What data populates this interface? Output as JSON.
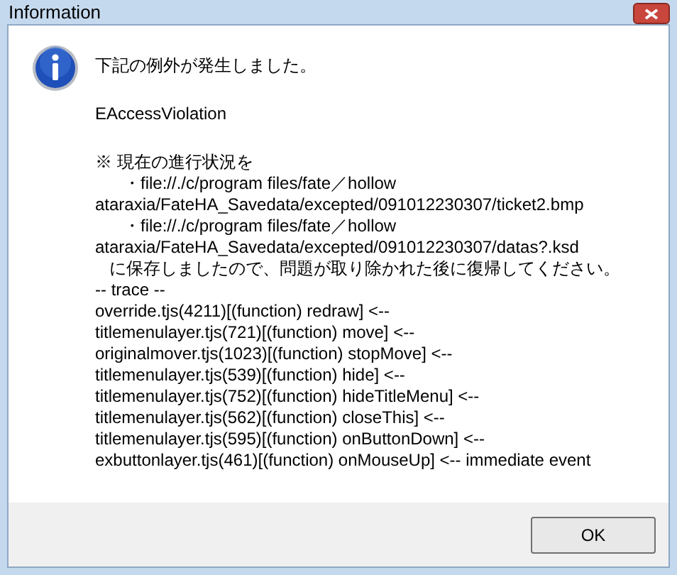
{
  "window": {
    "title": "Information"
  },
  "paragraphs": [
    [
      {
        "kind": "plain",
        "text": "下記の例外が発生しました。"
      }
    ],
    [
      {
        "kind": "plain",
        "text": "EAccessViolation"
      }
    ],
    [
      {
        "kind": "plain",
        "text": "※ 現在の進行状況を"
      },
      {
        "kind": "bullet",
        "text": "・file://./c/program files/fate／hollow"
      },
      {
        "kind": "plain",
        "text": "ataraxia/FateHA_Savedata/excepted/091012230307/ticket2.bmp"
      },
      {
        "kind": "bullet",
        "text": "・file://./c/program files/fate／hollow"
      },
      {
        "kind": "plain",
        "text": "ataraxia/FateHA_Savedata/excepted/091012230307/datas?.ksd"
      },
      {
        "kind": "note",
        "text": "に保存しましたので、問題が取り除かれた後に復帰してください。"
      },
      {
        "kind": "plain",
        "text": "-- trace --"
      },
      {
        "kind": "plain",
        "text": "override.tjs(4211)[(function) redraw] <--"
      },
      {
        "kind": "plain",
        "text": "titlemenulayer.tjs(721)[(function) move] <--"
      },
      {
        "kind": "plain",
        "text": "originalmover.tjs(1023)[(function) stopMove] <--"
      },
      {
        "kind": "plain",
        "text": "titlemenulayer.tjs(539)[(function) hide] <--"
      },
      {
        "kind": "plain",
        "text": "titlemenulayer.tjs(752)[(function) hideTitleMenu] <--"
      },
      {
        "kind": "plain",
        "text": "titlemenulayer.tjs(562)[(function) closeThis] <--"
      },
      {
        "kind": "plain",
        "text": "titlemenulayer.tjs(595)[(function) onButtonDown] <--"
      },
      {
        "kind": "plain",
        "text": "exbuttonlayer.tjs(461)[(function) onMouseUp] <-- immediate event"
      }
    ]
  ],
  "buttons": [
    "OK"
  ]
}
